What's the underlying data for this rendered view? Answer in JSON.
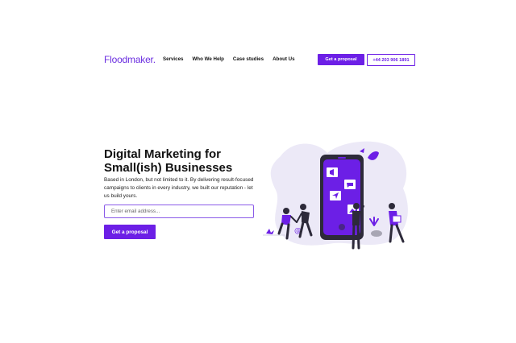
{
  "header": {
    "logo": "Floodmaker",
    "logo_dot": ".",
    "nav": [
      "Services",
      "Who We Help",
      "Case studies",
      "About Us"
    ],
    "cta_label": "Get a proposal",
    "phone": "+44 203 906 1891"
  },
  "hero": {
    "title_line1": "Digital Marketing for",
    "title_line2": "Small(ish) Businesses",
    "text": "Based in London, but not limited to it. By delivering result-focused campaigns to clients in every industry, we built our reputation - let us build yours.",
    "email_placeholder": "Enter email address...",
    "cta_label": "Get a proposal"
  },
  "colors": {
    "brand": "#6c1fe6",
    "blob": "#ece9f7",
    "dark": "#2d2a3a"
  }
}
